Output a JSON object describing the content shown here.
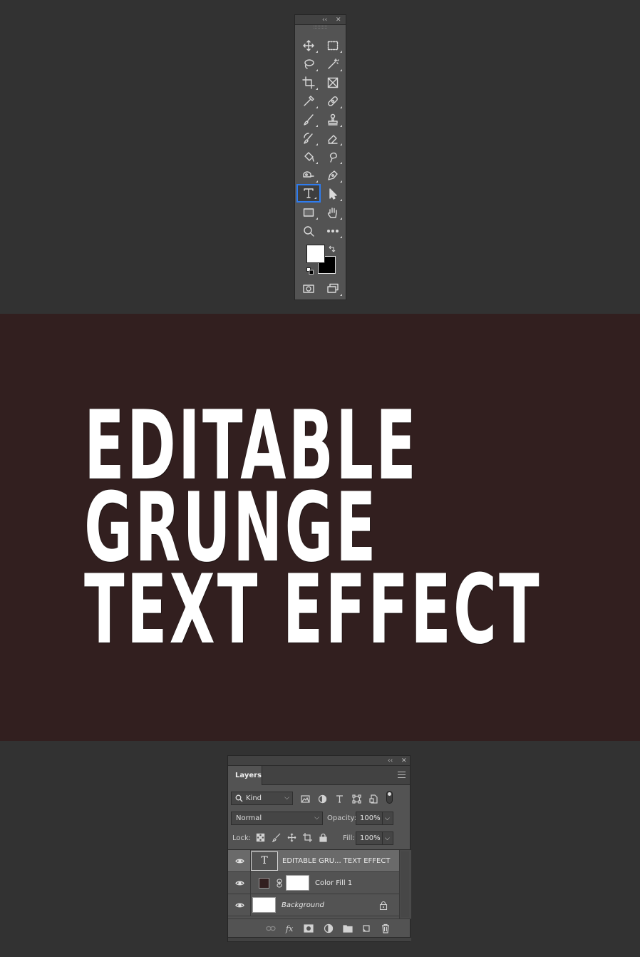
{
  "toolbar": {
    "collapse_glyph": "‹‹",
    "close_glyph": "✕",
    "tools": [
      {
        "name": "move-tool",
        "icon": "move-icon"
      },
      {
        "name": "marquee-tool",
        "icon": "rect-marquee-icon"
      },
      {
        "name": "lasso-tool",
        "icon": "lasso-icon"
      },
      {
        "name": "magic-wand-tool",
        "icon": "magic-wand-icon"
      },
      {
        "name": "crop-tool",
        "icon": "crop-icon"
      },
      {
        "name": "frame-tool",
        "icon": "frame-icon"
      },
      {
        "name": "eyedropper-tool",
        "icon": "eyedropper-icon"
      },
      {
        "name": "healing-brush-tool",
        "icon": "bandage-icon"
      },
      {
        "name": "brush-tool",
        "icon": "brush-icon"
      },
      {
        "name": "clone-stamp-tool",
        "icon": "stamp-icon"
      },
      {
        "name": "history-brush-tool",
        "icon": "history-brush-icon"
      },
      {
        "name": "eraser-tool",
        "icon": "eraser-icon"
      },
      {
        "name": "paint-bucket-tool",
        "icon": "bucket-icon"
      },
      {
        "name": "smudge-tool",
        "icon": "smudge-icon"
      },
      {
        "name": "dodge-tool",
        "icon": "dodge-icon"
      },
      {
        "name": "pen-tool",
        "icon": "pen-icon"
      },
      {
        "name": "type-tool",
        "icon": "type-icon",
        "active": true
      },
      {
        "name": "path-selection-tool",
        "icon": "arrow-icon"
      },
      {
        "name": "rectangle-tool",
        "icon": "rectangle-icon"
      },
      {
        "name": "hand-tool",
        "icon": "hand-icon"
      },
      {
        "name": "zoom-tool",
        "icon": "zoom-icon"
      },
      {
        "name": "more-tools",
        "icon": "more-icon"
      }
    ],
    "foreground_color": "#ffffff",
    "background_color": "#000000"
  },
  "canvas": {
    "background": "#321f1f",
    "lines": [
      "EDITABLE",
      "GRUNGE",
      "TEXT EFFECT"
    ]
  },
  "layers_panel": {
    "collapse_glyph": "‹‹",
    "close_glyph": "✕",
    "tab": "Layers",
    "filter_kind": "Kind",
    "blend_mode": "Normal",
    "opacity_label": "Opacity:",
    "opacity_value": "100%",
    "lock_label": "Lock:",
    "fill_label": "Fill:",
    "fill_value": "100%",
    "text_thumb": "T",
    "layers": [
      {
        "name": "EDITABLE GRU... TEXT EFFECT",
        "type": "text",
        "selected": true
      },
      {
        "name": "Color Fill 1",
        "type": "fill",
        "fill_color": "#321f1f"
      },
      {
        "name": "Background",
        "type": "background",
        "locked": true
      }
    ]
  }
}
